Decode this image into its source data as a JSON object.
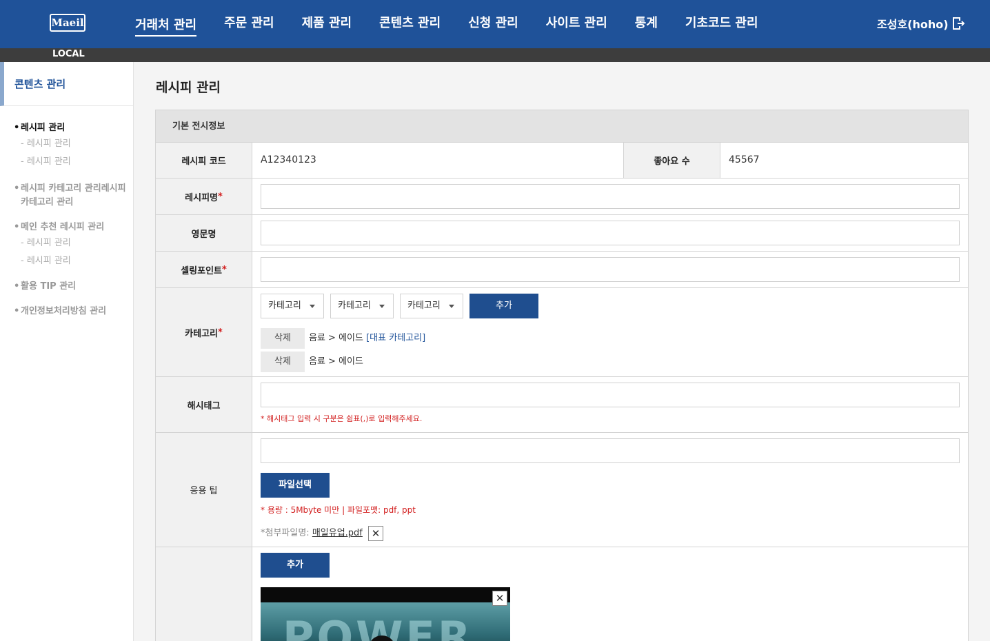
{
  "header": {
    "logo_text": "Maeil",
    "nav": [
      "거래처 관리",
      "주문 관리",
      "제품 관리",
      "콘텐츠 관리",
      "신청 관리",
      "사이트 관리",
      "통계",
      "기초코드 관리"
    ],
    "active_nav": "거래처 관리",
    "user": "조성호(hoho)",
    "logout_icon": "logout-icon",
    "env_label": "LOCAL",
    "colors": {
      "primary": "#1f5299",
      "envbar": "#3d3d3d"
    }
  },
  "sidebar": {
    "title": "콘텐츠 관리",
    "groups": [
      {
        "label": "레시피 관리",
        "active": true,
        "items": [
          "- 레시피 관리",
          "- 레시피 관리"
        ]
      },
      {
        "label": "레시피 카테고리 관리레시피 카테고리 관리",
        "items": []
      },
      {
        "label": "메인 추천 레시피 관리",
        "items": [
          "- 레시피 관리",
          "- 레시피 관리"
        ]
      },
      {
        "label": "활용 TIP 관리",
        "items": []
      },
      {
        "label": "개인정보처리방침 관리",
        "items": []
      }
    ]
  },
  "main": {
    "title": "레시피 관리",
    "section_title": "기본 전시정보",
    "recipe_code_label": "레시피 코드",
    "recipe_code_value": "A12340123",
    "likes_label": "좋아요 수",
    "likes_value": "45567",
    "recipe_name_label": "레시피명",
    "english_name_label": "영문명",
    "selling_point_label": "셀링포인트",
    "category_label": "카테고리",
    "category_selects": [
      "카테고리",
      "카테고리",
      "카테고리"
    ],
    "add_label": "추가",
    "category_rows": [
      {
        "delete": "삭제",
        "path": "음료 > 에이드",
        "tag": "[대표 카테고리]"
      },
      {
        "delete": "삭제",
        "path": "음료 > 에이드",
        "tag": ""
      }
    ],
    "hashtag_label": "해시태그",
    "hashtag_note": "* 해시태그 입력 시 구분은 쉼표(,)로 입력해주세요.",
    "tip_label": "응용 팁",
    "file_select": "파일선택",
    "file_note": "* 용량 : 5Mbyte 미만 | 파일포맷: pdf, ppt",
    "attach_label": "*첨부파일명:",
    "attach_file": "매일유업.pdf",
    "image_add": "추가",
    "required_mark": "*",
    "close_icon": "close-icon"
  }
}
